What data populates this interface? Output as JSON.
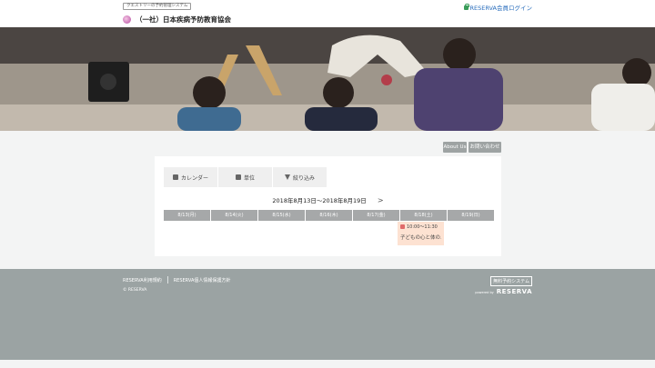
{
  "header": {
    "badge": "クエストリーの予約管理システム",
    "login_label": "RESERVA会員ログイン",
    "org_name": "（一社）日本疾病予防教育協会"
  },
  "actions": {
    "about": "About Us",
    "contact": "お問い合わせ"
  },
  "tabs": [
    {
      "label": "カレンダー",
      "icon": "calendar-icon"
    },
    {
      "label": "単位",
      "icon": "unit-icon"
    },
    {
      "label": "絞り込み",
      "icon": "filter-icon"
    }
  ],
  "calendar": {
    "range": "2018年8月13日〜2018年8月19日",
    "next": ">",
    "days": [
      "8/13(月)",
      "8/14(火)",
      "8/15(水)",
      "8/16(木)",
      "8/17(金)",
      "8/18(土)",
      "8/19(日)"
    ],
    "event": {
      "day": "8/18(土)",
      "time": "10:00〜11:30",
      "title": "子どもの心と体の..."
    }
  },
  "footer": {
    "link1": "RESERVA利用規約",
    "link2": "RESERVA個人情報保護方針",
    "copyright": "© RESERVA",
    "free_label": "無料予約システム",
    "powered_by": "powered by",
    "brand": "RESERVA"
  }
}
